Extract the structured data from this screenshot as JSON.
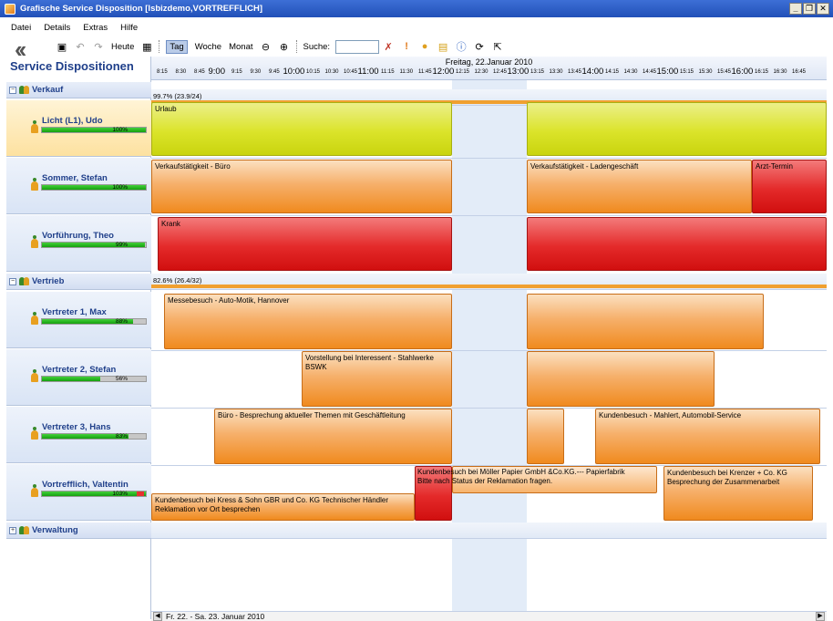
{
  "window": {
    "title": "Grafische Service Disposition [lsbizdemo,VORTREFFLICH]",
    "min": "_",
    "restore": "❐",
    "close": "✕"
  },
  "menu": [
    "Datei",
    "Details",
    "Extras",
    "Hilfe"
  ],
  "toolbar": {
    "heute": "Heute",
    "tag": "Tag",
    "woche": "Woche",
    "monat": "Monat",
    "suche_label": "Suche:",
    "search_value": ""
  },
  "sidebar": {
    "title": "Service Dispositionen",
    "groups": [
      {
        "label": "Verkauf",
        "toggle": "−"
      },
      {
        "label": "Vertrieb",
        "toggle": "−"
      },
      {
        "label": "Verwaltung",
        "toggle": "+"
      }
    ],
    "people": [
      {
        "name": "Licht (L1), Udo",
        "percent": "100%",
        "fill": 1.0
      },
      {
        "name": "Sommer, Stefan",
        "percent": "100%",
        "fill": 1.0
      },
      {
        "name": "Vorführung, Theo",
        "percent": "99%",
        "fill": 0.99
      },
      {
        "name": "Vertreter 1, Max",
        "percent": "88%",
        "fill": 0.88
      },
      {
        "name": "Vertreter 2, Stefan",
        "percent": "56%",
        "fill": 0.56
      },
      {
        "name": "Vertreter 3, Hans",
        "percent": "83%",
        "fill": 0.83
      },
      {
        "name": "Vortrefflich, Valtentin",
        "percent": "103%",
        "fill": 1.0
      }
    ]
  },
  "timeline": {
    "date": "Freitag, 22.Januar 2010",
    "ticks_small": [
      "8:15",
      "8:30",
      "8:45",
      "9:15",
      "9:30",
      "9:45",
      "10:15",
      "10:30",
      "10:45",
      "11:15",
      "11:30",
      "11:45",
      "12:15",
      "12:30",
      "12:45",
      "13:15",
      "13:30",
      "13:45",
      "14:15",
      "14:30",
      "14:45",
      "15:15",
      "15:30",
      "15:45",
      "16:15",
      "16:30",
      "16:45"
    ],
    "ticks_big": [
      "9:00",
      "10:00",
      "11:00",
      "12:00",
      "13:00",
      "14:00",
      "15:00",
      "16:00"
    ],
    "group_stats": {
      "verkauf": "99.7% (23.9/24)",
      "vertrieb": "82.6% (26.4/32)"
    },
    "appointments": {
      "urlaub": "Urlaub",
      "buero": "Verkaufstätigkeit - Büro",
      "laden": "Verkaufstätigkeit - Ladengeschäft",
      "arzt": "Arzt-Termin",
      "krank": "Krank",
      "messe": "Messebesuch - Auto-Motik, Hannover",
      "vorstellung": "Vorstellung bei Interessent - Stahlwerke BSWK",
      "besprechung": "Büro - Besprechung aktueller Themen mit Geschäftleitung",
      "mahlert": "Kundenbesuch - Mahlert, Automobil-Service",
      "moeller_1": "Kundenbesuch bei Möller Papier GmbH &Co.KG.--- Papierfabrik",
      "moeller_2": "Bitte nach Status der Reklamation fragen.",
      "krenzer_1": "Kundenbesuch bei Krenzer + Co. KG",
      "krenzer_2": "Besprechung der Zusammenarbeit",
      "kress_1": "Kundenbesuch bei Kress & Sohn GBR und Co. KG Technischer Händler",
      "kress_2": "Reklamation vor Ort besprechen"
    }
  },
  "footer": {
    "range": "Fr. 22. - Sa. 23. Januar 2010",
    "left": "◀",
    "right": "▶"
  },
  "colors": {
    "accent": "#1f3f8a",
    "orange": "#f08a1e",
    "yellow": "#dbe42a",
    "red": "#e42a2a"
  }
}
